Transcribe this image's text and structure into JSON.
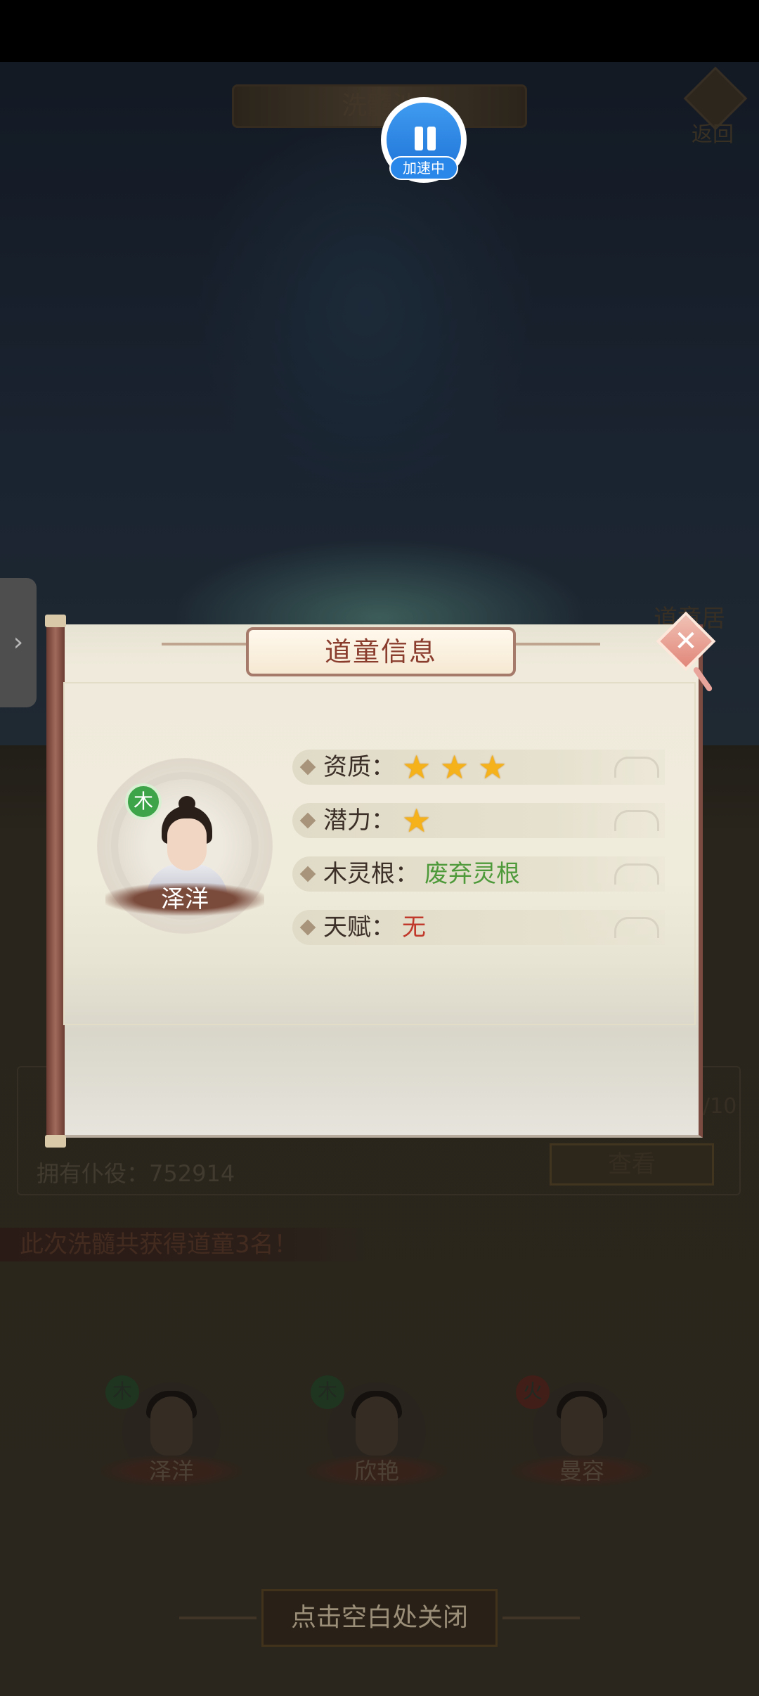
{
  "background": {
    "title": "洗髓池",
    "back_label": "返回",
    "side_arrow": "›",
    "side_label": "道童居",
    "servants_label": "拥有仆役：",
    "servants_value": "752914",
    "view_button": "查看",
    "count_text": "/10",
    "result_text": "此次洗髓共获得道童3名！",
    "characters": [
      {
        "name": "泽洋",
        "element": "木"
      },
      {
        "name": "欣艳",
        "element": "木"
      },
      {
        "name": "曼容",
        "element": "火"
      }
    ],
    "close_hint": "点击空白处关闭"
  },
  "speed_badge": {
    "label": "加速中"
  },
  "dialog": {
    "title": "道童信息",
    "character": {
      "name": "泽洋",
      "element": "木"
    },
    "attributes": {
      "aptitude_label": "资质：",
      "aptitude_stars": 3,
      "potential_label": "潜力：",
      "potential_stars": 1,
      "root_label": "木灵根：",
      "root_value": "废弃灵根",
      "talent_label": "天赋：",
      "talent_value": "无"
    }
  },
  "colors": {
    "root_value": "#4e9a3a",
    "talent_value": "#c0392b",
    "title_text": "#8a3c2d",
    "wood_element": "#3ea44a",
    "star": "#f5b21a"
  }
}
